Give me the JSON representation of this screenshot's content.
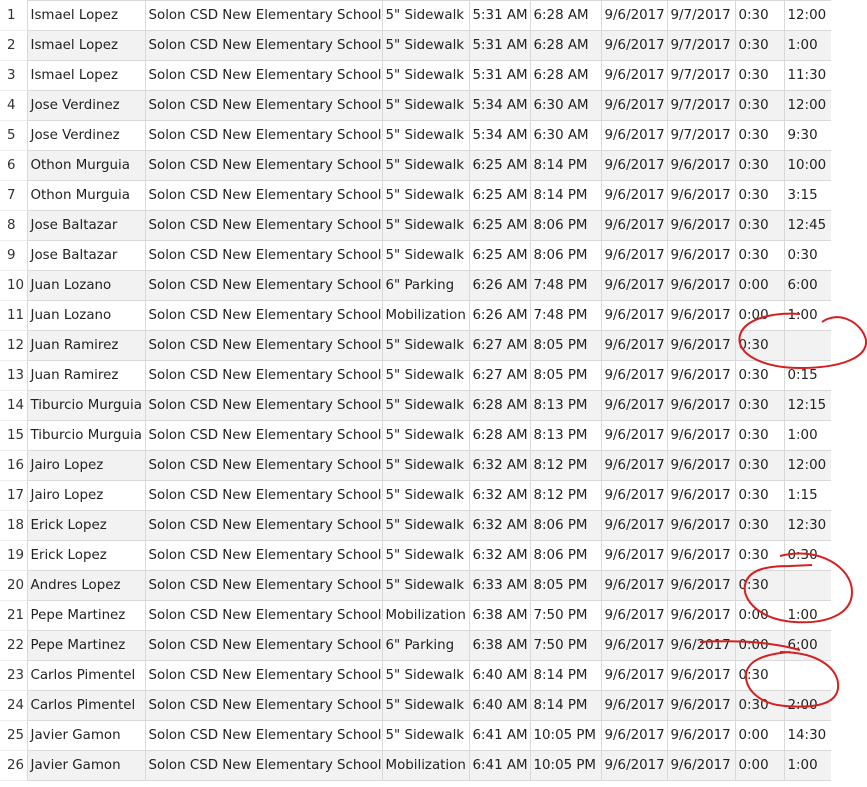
{
  "rows": [
    [
      "1",
      "Ismael Lopez",
      "Solon CSD New Elementary School",
      "5\" Sidewalk",
      "5:31 AM",
      "6:28 AM",
      "9/6/2017",
      "9/7/2017",
      "0:30",
      "12:00"
    ],
    [
      "2",
      "Ismael Lopez",
      "Solon CSD New Elementary School",
      "5\" Sidewalk",
      "5:31 AM",
      "6:28 AM",
      "9/6/2017",
      "9/7/2017",
      "0:30",
      "1:00"
    ],
    [
      "3",
      "Ismael Lopez",
      "Solon CSD New Elementary School",
      "5\" Sidewalk",
      "5:31 AM",
      "6:28 AM",
      "9/6/2017",
      "9/7/2017",
      "0:30",
      "11:30"
    ],
    [
      "4",
      "Jose Verdinez",
      "Solon CSD New Elementary School",
      "5\" Sidewalk",
      "5:34 AM",
      "6:30 AM",
      "9/6/2017",
      "9/7/2017",
      "0:30",
      "12:00"
    ],
    [
      "5",
      "Jose Verdinez",
      "Solon CSD New Elementary School",
      "5\" Sidewalk",
      "5:34 AM",
      "6:30 AM",
      "9/6/2017",
      "9/7/2017",
      "0:30",
      "9:30"
    ],
    [
      "6",
      "Othon Murguia",
      "Solon CSD New Elementary School",
      "5\" Sidewalk",
      "6:25 AM",
      "8:14 PM",
      "9/6/2017",
      "9/6/2017",
      "0:30",
      "10:00"
    ],
    [
      "7",
      "Othon Murguia",
      "Solon CSD New Elementary School",
      "5\" Sidewalk",
      "6:25 AM",
      "8:14 PM",
      "9/6/2017",
      "9/6/2017",
      "0:30",
      "3:15"
    ],
    [
      "8",
      "Jose Baltazar",
      "Solon CSD New Elementary School",
      "5\" Sidewalk",
      "6:25 AM",
      "8:06 PM",
      "9/6/2017",
      "9/6/2017",
      "0:30",
      "12:45"
    ],
    [
      "9",
      "Jose Baltazar",
      "Solon CSD New Elementary School",
      "5\" Sidewalk",
      "6:25 AM",
      "8:06 PM",
      "9/6/2017",
      "9/6/2017",
      "0:30",
      "0:30"
    ],
    [
      "10",
      "Juan Lozano",
      "Solon CSD New Elementary School",
      "6\" Parking",
      "6:26 AM",
      "7:48 PM",
      "9/6/2017",
      "9/6/2017",
      "0:00",
      "6:00"
    ],
    [
      "11",
      "Juan Lozano",
      "Solon CSD New Elementary School",
      "Mobilization",
      "6:26 AM",
      "7:48 PM",
      "9/6/2017",
      "9/6/2017",
      "0:00",
      "1:00"
    ],
    [
      "12",
      "Juan Ramirez",
      "Solon CSD New Elementary School",
      "5\" Sidewalk",
      "6:27 AM",
      "8:05 PM",
      "9/6/2017",
      "9/6/2017",
      "0:30",
      ""
    ],
    [
      "13",
      "Juan Ramirez",
      "Solon CSD New Elementary School",
      "5\" Sidewalk",
      "6:27 AM",
      "8:05 PM",
      "9/6/2017",
      "9/6/2017",
      "0:30",
      "0:15"
    ],
    [
      "14",
      "Tiburcio Murguia",
      "Solon CSD New Elementary School",
      "5\" Sidewalk",
      "6:28 AM",
      "8:13 PM",
      "9/6/2017",
      "9/6/2017",
      "0:30",
      "12:15"
    ],
    [
      "15",
      "Tiburcio Murguia",
      "Solon CSD New Elementary School",
      "5\" Sidewalk",
      "6:28 AM",
      "8:13 PM",
      "9/6/2017",
      "9/6/2017",
      "0:30",
      "1:00"
    ],
    [
      "16",
      "Jairo Lopez",
      "Solon CSD New Elementary School",
      "5\" Sidewalk",
      "6:32 AM",
      "8:12 PM",
      "9/6/2017",
      "9/6/2017",
      "0:30",
      "12:00"
    ],
    [
      "17",
      "Jairo Lopez",
      "Solon CSD New Elementary School",
      "5\" Sidewalk",
      "6:32 AM",
      "8:12 PM",
      "9/6/2017",
      "9/6/2017",
      "0:30",
      "1:15"
    ],
    [
      "18",
      "Erick Lopez",
      "Solon CSD New Elementary School",
      "5\" Sidewalk",
      "6:32 AM",
      "8:06 PM",
      "9/6/2017",
      "9/6/2017",
      "0:30",
      "12:30"
    ],
    [
      "19",
      "Erick Lopez",
      "Solon CSD New Elementary School",
      "5\" Sidewalk",
      "6:32 AM",
      "8:06 PM",
      "9/6/2017",
      "9/6/2017",
      "0:30",
      "0:30"
    ],
    [
      "20",
      "Andres Lopez",
      "Solon CSD New Elementary School",
      "5\" Sidewalk",
      "6:33 AM",
      "8:05 PM",
      "9/6/2017",
      "9/6/2017",
      "0:30",
      ""
    ],
    [
      "21",
      "Pepe Martinez",
      "Solon CSD New Elementary School",
      "Mobilization",
      "6:38 AM",
      "7:50 PM",
      "9/6/2017",
      "9/6/2017",
      "0:00",
      "1:00"
    ],
    [
      "22",
      "Pepe Martinez",
      "Solon CSD New Elementary School",
      "6\" Parking",
      "6:38 AM",
      "7:50 PM",
      "9/6/2017",
      "9/6/2017",
      "0:00",
      "6:00"
    ],
    [
      "23",
      "Carlos Pimentel",
      "Solon CSD New Elementary School",
      "5\" Sidewalk",
      "6:40 AM",
      "8:14 PM",
      "9/6/2017",
      "9/6/2017",
      "0:30",
      ""
    ],
    [
      "24",
      "Carlos Pimentel",
      "Solon CSD New Elementary School",
      "5\" Sidewalk",
      "6:40 AM",
      "8:14 PM",
      "9/6/2017",
      "9/6/2017",
      "0:30",
      "2:00"
    ],
    [
      "25",
      "Javier Gamon",
      "Solon CSD New Elementary School",
      "5\" Sidewalk",
      "6:41 AM",
      "10:05 PM",
      "9/6/2017",
      "9/6/2017",
      "0:00",
      "14:30"
    ],
    [
      "26",
      "Javier Gamon",
      "Solon CSD New Elementary School",
      "Mobilization",
      "6:41 AM",
      "10:05 PM",
      "9/6/2017",
      "9/6/2017",
      "0:00",
      "1:00"
    ]
  ],
  "annotation_color": "#d42020"
}
